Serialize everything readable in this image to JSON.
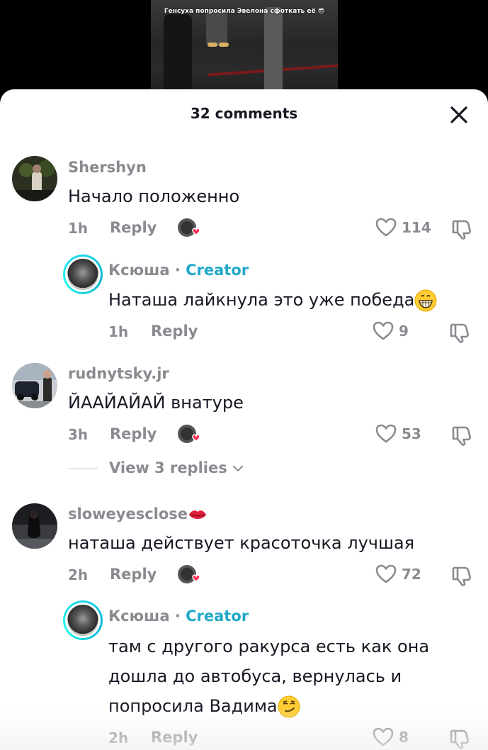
{
  "video": {
    "caption": "Генсуха попросила Эвелона сфоткать её 😎"
  },
  "sheet": {
    "title": "32 comments",
    "close_icon": "close-icon"
  },
  "comments": [
    {
      "username": "Shershyn",
      "text": "Начало положенно",
      "time": "1h",
      "reply_label": "Reply",
      "likes": "114"
    },
    {
      "username": "Ксюша",
      "creator_label": "Creator",
      "separator": "·",
      "text": "Наташа лайкнула это уже победа",
      "emoji": "grinning-face-emoji",
      "time": "1h",
      "reply_label": "Reply",
      "likes": "9"
    },
    {
      "username": "rudnytsky.jr",
      "text": "ЙААЙАЙАЙ внатуре",
      "time": "3h",
      "reply_label": "Reply",
      "likes": "53",
      "view_replies": "View 3 replies"
    },
    {
      "username": "sloweyesclose",
      "username_emoji": "lips-emoji",
      "text": "наташа действует красоточка лучшая",
      "time": "2h",
      "reply_label": "Reply",
      "likes": "72"
    },
    {
      "username": "Ксюша",
      "creator_label": "Creator",
      "separator": "·",
      "text_line1": "там с другого ракурса есть как она",
      "text_line2": "дошла до автобуса, вернулась и",
      "text_line3": "попросила Вадима",
      "emoji": "smirking-face-emoji",
      "time": "2h",
      "reply_label": "Reply",
      "likes": "8"
    }
  ],
  "colors": {
    "text_primary": "#161823",
    "text_secondary": "#8a8b91",
    "creator": "#20a8c8",
    "heart_badge": "#fe2c55"
  }
}
